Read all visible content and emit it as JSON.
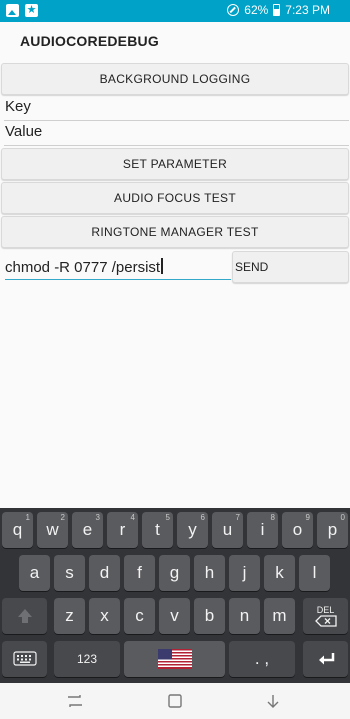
{
  "status_bar": {
    "battery": "62%",
    "time": "7:23 PM"
  },
  "app": {
    "title": "AUDIOCOREDEBUG"
  },
  "buttons": {
    "background_logging": "BACKGROUND LOGGING",
    "set_parameter": "SET PARAMETER",
    "audio_focus_test": "AUDIO FOCUS TEST",
    "ringtone_manager_test": "RINGTONE MANAGER TEST",
    "send": "SEND"
  },
  "fields": {
    "key_label": "Key",
    "value_label": "Value",
    "command_value": "chmod -R 0777 /persist"
  },
  "keyboard": {
    "row1": [
      {
        "k": "q",
        "h": "1"
      },
      {
        "k": "w",
        "h": "2"
      },
      {
        "k": "e",
        "h": "3"
      },
      {
        "k": "r",
        "h": "4"
      },
      {
        "k": "t",
        "h": "5"
      },
      {
        "k": "y",
        "h": "6"
      },
      {
        "k": "u",
        "h": "7"
      },
      {
        "k": "i",
        "h": "8"
      },
      {
        "k": "o",
        "h": "9"
      },
      {
        "k": "p",
        "h": "0"
      }
    ],
    "row2": [
      "a",
      "s",
      "d",
      "f",
      "g",
      "h",
      "j",
      "k",
      "l"
    ],
    "row3": [
      "z",
      "x",
      "c",
      "v",
      "b",
      "n",
      "m"
    ],
    "del_label": "DEL",
    "numbers_label": "123",
    "period_comma": ". ,"
  }
}
